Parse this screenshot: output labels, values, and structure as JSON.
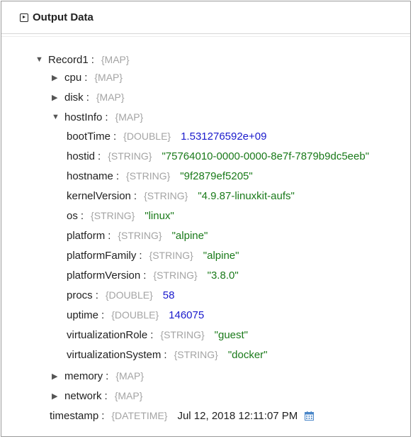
{
  "panel": {
    "title": "Output Data",
    "icon": "output-icon"
  },
  "tree": {
    "record": {
      "key": "Record1",
      "type": "{MAP}",
      "expanded": true
    },
    "cpu": {
      "key": "cpu",
      "type": "{MAP}",
      "expanded": false
    },
    "disk": {
      "key": "disk",
      "type": "{MAP}",
      "expanded": false
    },
    "hostInfo": {
      "key": "hostInfo",
      "type": "{MAP}",
      "expanded": true
    },
    "fields": [
      {
        "key": "bootTime",
        "type": "{DOUBLE}",
        "value": "1.531276592e+09",
        "kind": "num"
      },
      {
        "key": "hostid",
        "type": "{STRING}",
        "value": "\"75764010-0000-0000-8e7f-7879b9dc5eeb\"",
        "kind": "str"
      },
      {
        "key": "hostname",
        "type": "{STRING}",
        "value": "\"9f2879ef5205\"",
        "kind": "str"
      },
      {
        "key": "kernelVersion",
        "type": "{STRING}",
        "value": "\"4.9.87-linuxkit-aufs\"",
        "kind": "str"
      },
      {
        "key": "os",
        "type": "{STRING}",
        "value": "\"linux\"",
        "kind": "str"
      },
      {
        "key": "platform",
        "type": "{STRING}",
        "value": "\"alpine\"",
        "kind": "str"
      },
      {
        "key": "platformFamily",
        "type": "{STRING}",
        "value": "\"alpine\"",
        "kind": "str"
      },
      {
        "key": "platformVersion",
        "type": "{STRING}",
        "value": "\"3.8.0\"",
        "kind": "str"
      },
      {
        "key": "procs",
        "type": "{DOUBLE}",
        "value": "58",
        "kind": "num"
      },
      {
        "key": "uptime",
        "type": "{DOUBLE}",
        "value": "146075",
        "kind": "num"
      },
      {
        "key": "virtualizationRole",
        "type": "{STRING}",
        "value": "\"guest\"",
        "kind": "str"
      },
      {
        "key": "virtualizationSystem",
        "type": "{STRING}",
        "value": "\"docker\"",
        "kind": "str"
      }
    ],
    "memory": {
      "key": "memory",
      "type": "{MAP}",
      "expanded": false
    },
    "network": {
      "key": "network",
      "type": "{MAP}",
      "expanded": false
    },
    "timestamp": {
      "key": "timestamp",
      "type": "{DATETIME}",
      "value": "Jul 12, 2018 12:11:07 PM",
      "icon": "calendar-icon"
    }
  },
  "colors": {
    "string": "#1a7a1a",
    "number": "#1a1acc",
    "type": "#a4a4a4",
    "calendar": "#4a86c8"
  },
  "symbols": {
    "expanded": "▼",
    "collapsed": "▶",
    "colon": ":"
  }
}
